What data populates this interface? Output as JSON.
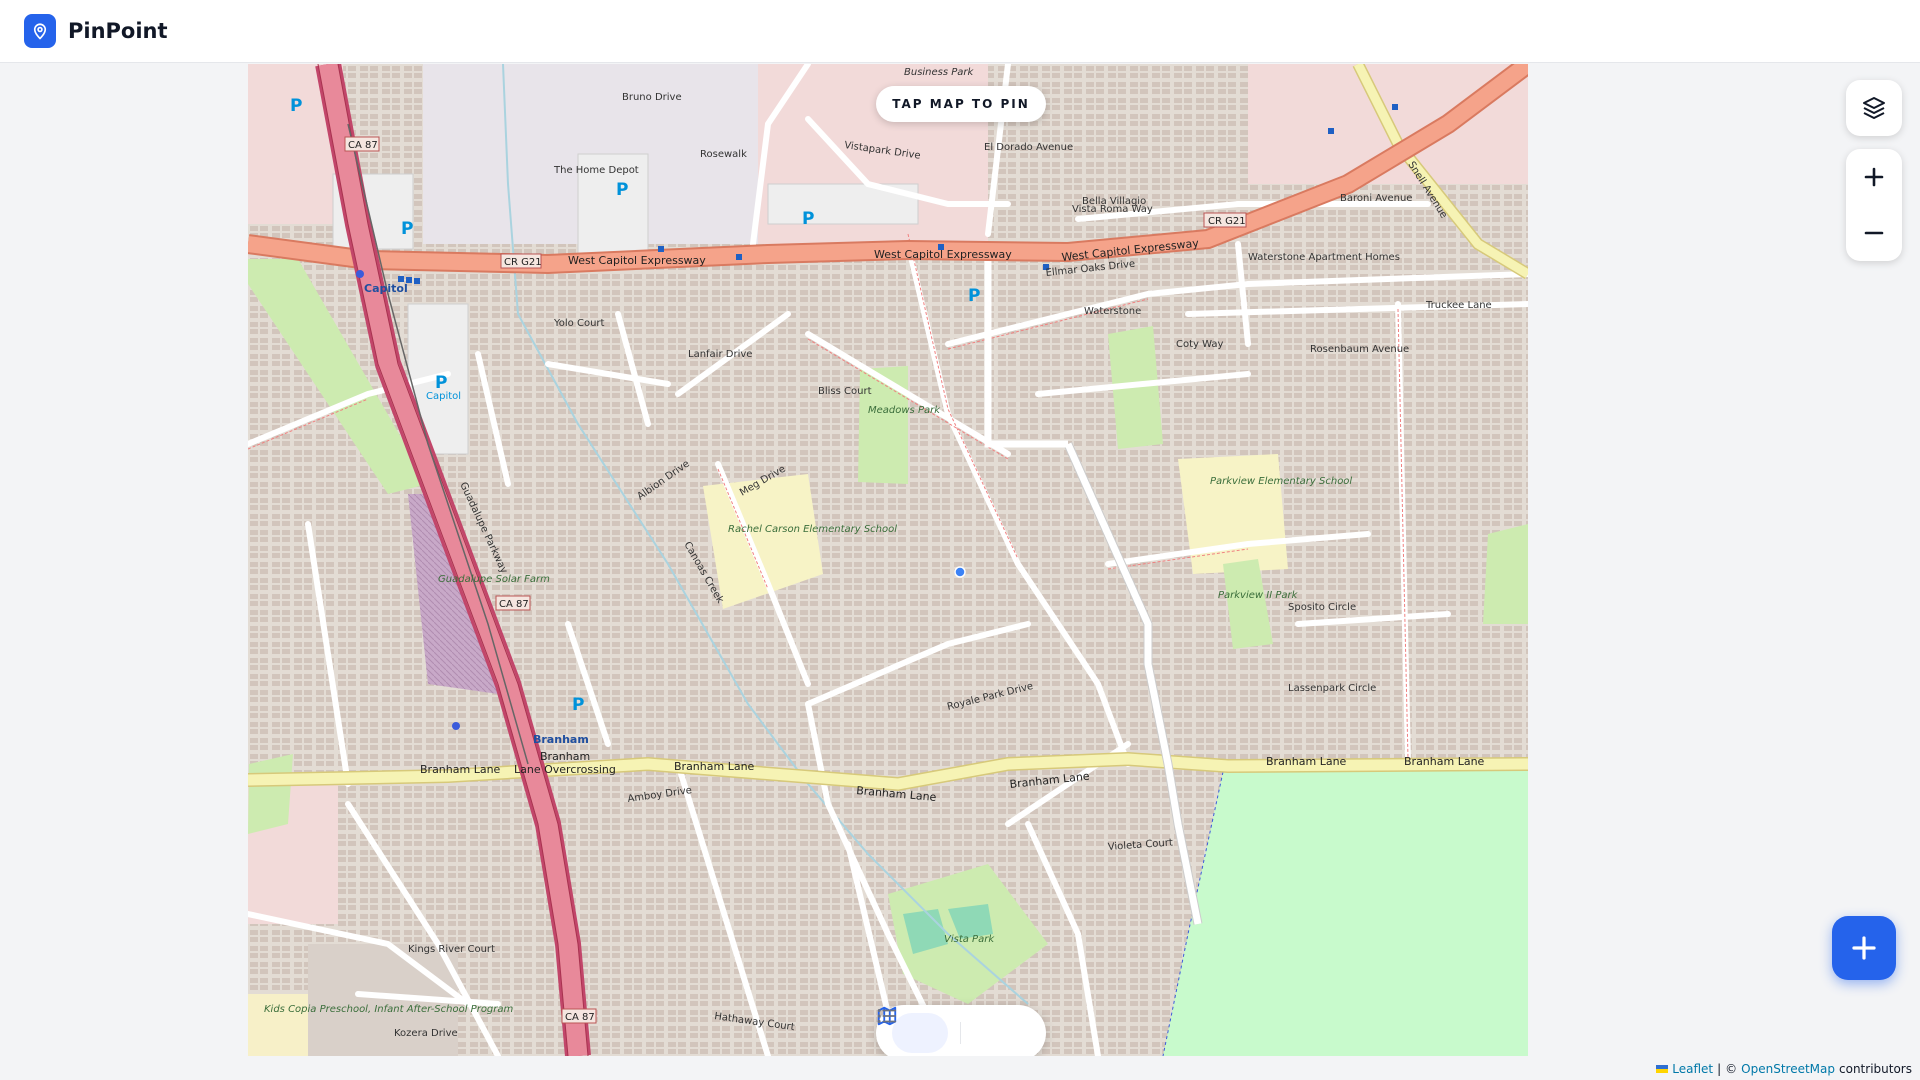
{
  "app": {
    "name": "PinPoint"
  },
  "map": {
    "hint": "TAP MAP TO PIN",
    "attribution": {
      "leaflet": "Leaflet",
      "separator": "|",
      "copy": "©",
      "osm": "OpenStreetMap",
      "suffix": "contributors"
    },
    "labels": {
      "west_capitol_1": "West Capitol Expressway",
      "west_capitol_2": "West Capitol Expressway",
      "west_capitol_3": "West Capitol Expressway",
      "cr_g21_1": "CR G21",
      "cr_g21_2": "CR G21",
      "ca87_1": "CA 87",
      "ca87_2": "CA 87",
      "ca87_3": "CA 87",
      "branham_lane_1": "Branham Lane",
      "branham_lane_2": "Branham Lane",
      "branham_lane_3": "Branham Lane",
      "branham_lane_4": "Branham Lane",
      "branham_lane_5": "Branham Lane",
      "branham_lane_6": "Branham Lane",
      "lane_overcrossing": "Lane Overcrossing",
      "branham_station": "Branham",
      "capitol_station": "Capitol",
      "capitol_p": "Capitol",
      "guadalupe_parkway": "Guadalupe Parkway",
      "home_depot": "The Home Depot",
      "rosewalk": "Rosewalk",
      "vistapark_drive": "Vistapark Drive",
      "ellmar_oaks": "Ellmar Oaks Drive",
      "waterstone": "Waterstone",
      "waterstone_apts": "Waterstone Apartment Homes",
      "bella_villagio": "Bella Villagio",
      "meadows_park": "Meadows Park",
      "rachel_carson": "Rachel Carson Elementary School",
      "parkview_school": "Parkview Elementary School",
      "parkview_ii": "Parkview II Park",
      "vista_park": "Vista Park",
      "solar_farm": "Guadalupe Solar Farm",
      "canoas_creek": "Canoas Creek",
      "rosenbaum": "Rosenbaum Avenue",
      "coty_way": "Coty Way",
      "sposito": "Sposito Circle",
      "lassenpark": "Lassenpark Circle",
      "royale_park": "Royale Park Drive",
      "kings_river": "Kings River Court",
      "kozera": "Kozera Drive",
      "preschool": "Kids Copia Preschool, Infant After-School Program",
      "bliss": "Bliss Court",
      "lanfair": "Lanfair Drive",
      "yolo": "Yolo Court",
      "meg": "Meg Drive",
      "albion": "Albion Drive",
      "violeta": "Violeta Court",
      "amboy": "Amboy Drive",
      "hathaway": "Hathaway Court",
      "snell": "Snell Avenue",
      "baroni": "Baroni Avenue",
      "truckee": "Truckee Lane",
      "vista_roma": "Vista Roma Way",
      "el_dorado": "El Dorado Avenue",
      "bruno": "Bruno Drive",
      "business_park": "Business Park"
    }
  },
  "controls": {
    "layers_icon": "layers-icon",
    "zoom_in_icon": "plus-icon",
    "zoom_out_icon": "minus-icon",
    "add_icon": "plus-icon",
    "map_view_icon": "map-icon",
    "list_view_icon": "list-icon"
  },
  "colors": {
    "accent": "#2563eb",
    "motorway": "#e8899a",
    "trunk": "#f3a78e",
    "primary": "#f6f3b4",
    "park": "#cdebb0",
    "grass": "#c8facc"
  }
}
